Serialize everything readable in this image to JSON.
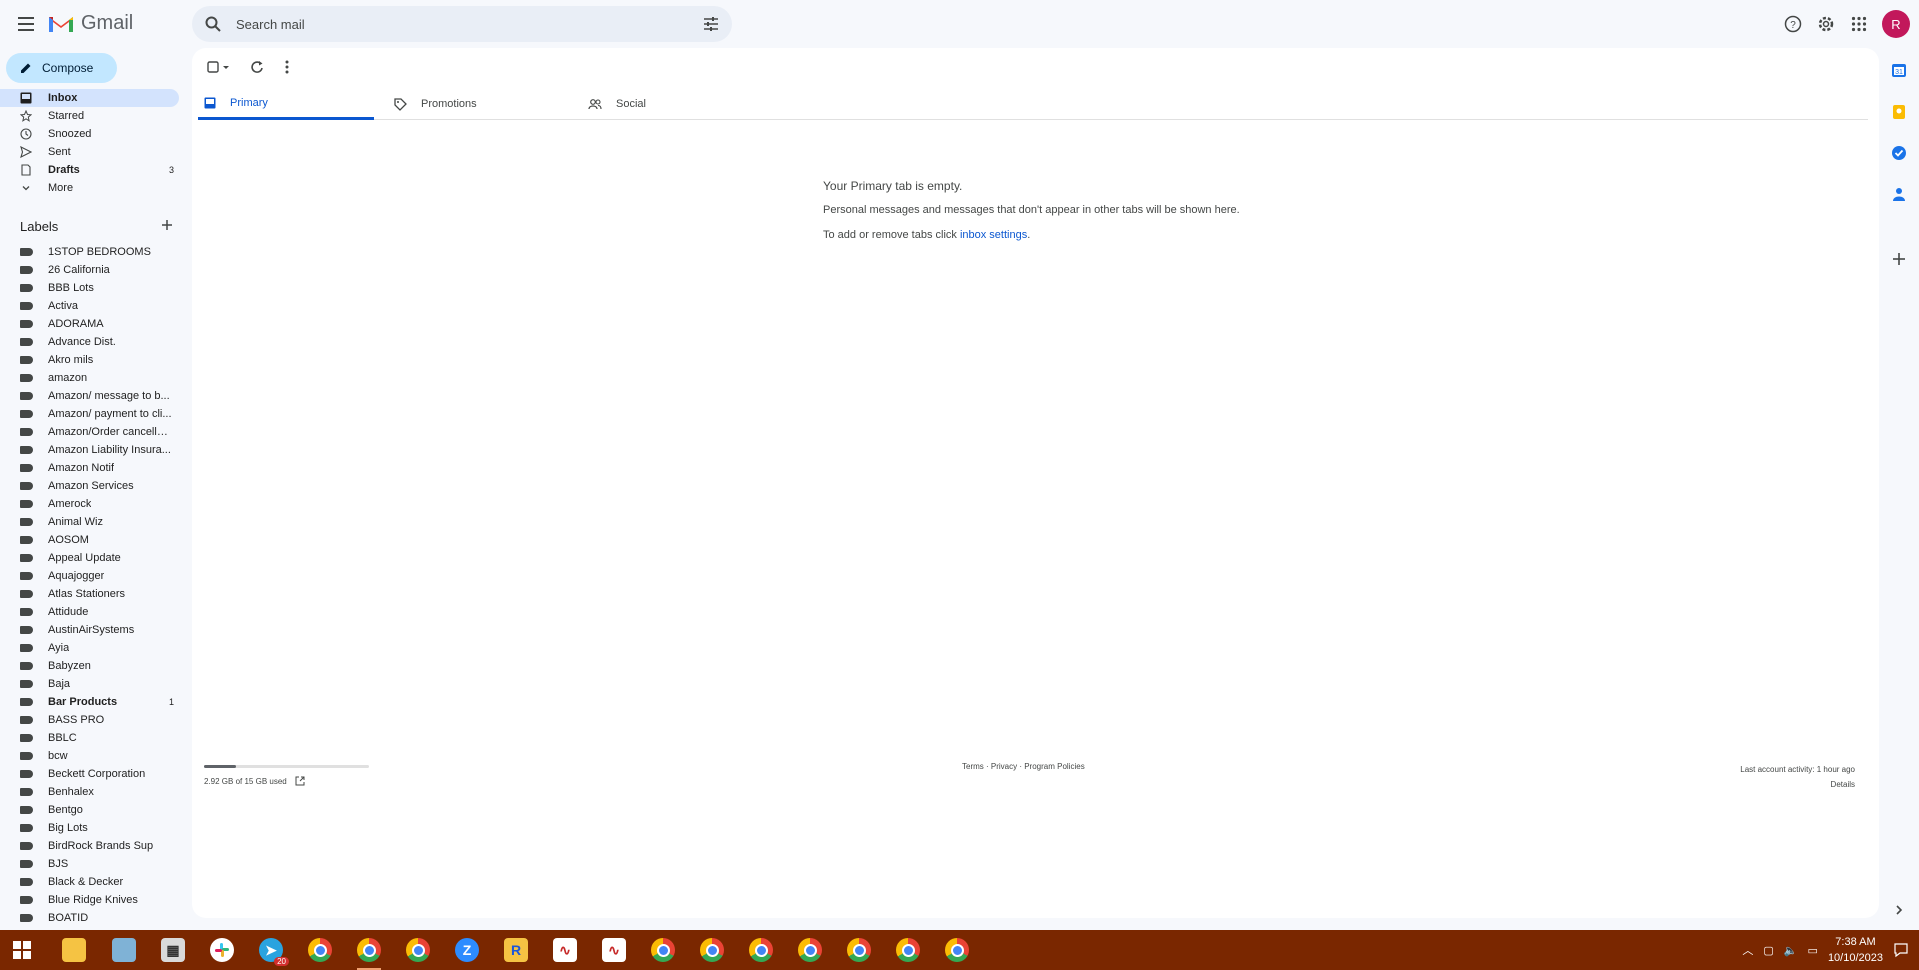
{
  "app": {
    "brand": "Gmail"
  },
  "search": {
    "placeholder": "Search mail"
  },
  "header": {
    "avatar_letter": "R"
  },
  "compose": {
    "label": "Compose"
  },
  "nav": [
    {
      "label": "Inbox",
      "icon": "inbox-icon",
      "active": true,
      "count": ""
    },
    {
      "label": "Starred",
      "icon": "star-icon",
      "active": false,
      "count": ""
    },
    {
      "label": "Snoozed",
      "icon": "clock-icon",
      "active": false,
      "count": ""
    },
    {
      "label": "Sent",
      "icon": "send-icon",
      "active": false,
      "count": ""
    },
    {
      "label": "Drafts",
      "icon": "draft-icon",
      "active": false,
      "count": "3"
    },
    {
      "label": "More",
      "icon": "chevron-down-icon",
      "active": false,
      "count": ""
    }
  ],
  "labels_section": {
    "title": "Labels"
  },
  "labels": [
    {
      "label": "1STOP BEDROOMS",
      "count": ""
    },
    {
      "label": "26 California",
      "count": ""
    },
    {
      "label": "BBB Lots",
      "count": ""
    },
    {
      "label": "Activa",
      "count": ""
    },
    {
      "label": "ADORAMA",
      "count": ""
    },
    {
      "label": "Advance Dist.",
      "count": ""
    },
    {
      "label": "Akro mils",
      "count": ""
    },
    {
      "label": "amazon",
      "count": ""
    },
    {
      "label": "Amazon/ message to b...",
      "count": ""
    },
    {
      "label": "Amazon/ payment to cli...",
      "count": ""
    },
    {
      "label": "Amazon/Order cancella...",
      "count": ""
    },
    {
      "label": "Amazon Liability Insura...",
      "count": ""
    },
    {
      "label": "Amazon Notif",
      "count": ""
    },
    {
      "label": "Amazon Services",
      "count": ""
    },
    {
      "label": "Amerock",
      "count": ""
    },
    {
      "label": "Animal Wiz",
      "count": ""
    },
    {
      "label": "AOSOM",
      "count": ""
    },
    {
      "label": "Appeal Update",
      "count": ""
    },
    {
      "label": "Aquajogger",
      "count": ""
    },
    {
      "label": "Atlas Stationers",
      "count": ""
    },
    {
      "label": "Attidude",
      "count": ""
    },
    {
      "label": "AustinAirSystems",
      "count": ""
    },
    {
      "label": "Ayia",
      "count": ""
    },
    {
      "label": "Babyzen",
      "count": ""
    },
    {
      "label": "Baja",
      "count": ""
    },
    {
      "label": "Bar Products",
      "count": "1",
      "bold": true
    },
    {
      "label": "BASS PRO",
      "count": ""
    },
    {
      "label": "BBLC",
      "count": ""
    },
    {
      "label": "bcw",
      "count": ""
    },
    {
      "label": "Beckett Corporation",
      "count": ""
    },
    {
      "label": "Benhalex",
      "count": ""
    },
    {
      "label": "Bentgo",
      "count": ""
    },
    {
      "label": "Big Lots",
      "count": ""
    },
    {
      "label": "BirdRock Brands Sup",
      "count": ""
    },
    {
      "label": "BJS",
      "count": ""
    },
    {
      "label": "Black & Decker",
      "count": ""
    },
    {
      "label": "Blue Ridge Knives",
      "count": ""
    },
    {
      "label": "BOATID",
      "count": ""
    }
  ],
  "tabs": [
    {
      "label": "Primary",
      "icon": "inbox-tab-icon",
      "active": true
    },
    {
      "label": "Promotions",
      "icon": "tag-icon",
      "active": false
    },
    {
      "label": "Social",
      "icon": "people-icon",
      "active": false
    }
  ],
  "empty_state": {
    "title": "Your Primary tab is empty.",
    "body": "Personal messages and messages that don't appear in other tabs will be shown here.",
    "settings_prefix": "To add or remove tabs click ",
    "settings_link": "inbox settings",
    "settings_suffix": "."
  },
  "footer": {
    "storage_text": "2.92 GB of 15 GB used",
    "storage_used_fraction": 0.195,
    "links": "Terms · Privacy · Program Policies",
    "activity": "Last account activity: 1 hour ago",
    "details": "Details"
  },
  "taskbar": {
    "time": "7:38 AM",
    "date": "10/10/2023",
    "badge": "20",
    "apps": [
      "windows-start",
      "file-explorer",
      "notepad",
      "calculator",
      "slack",
      "telegram",
      "chrome",
      "chrome",
      "chrome",
      "zoom",
      "rakuten",
      "stock-app",
      "stock-app",
      "chrome",
      "chrome",
      "chrome",
      "chrome",
      "chrome",
      "chrome",
      "chrome"
    ]
  },
  "colors": {
    "accent": "#0b57d0",
    "compose_bg": "#c2e7ff",
    "active_nav": "#d3e3fd",
    "taskbar": "#7a2700",
    "avatar": "#c2185b"
  }
}
